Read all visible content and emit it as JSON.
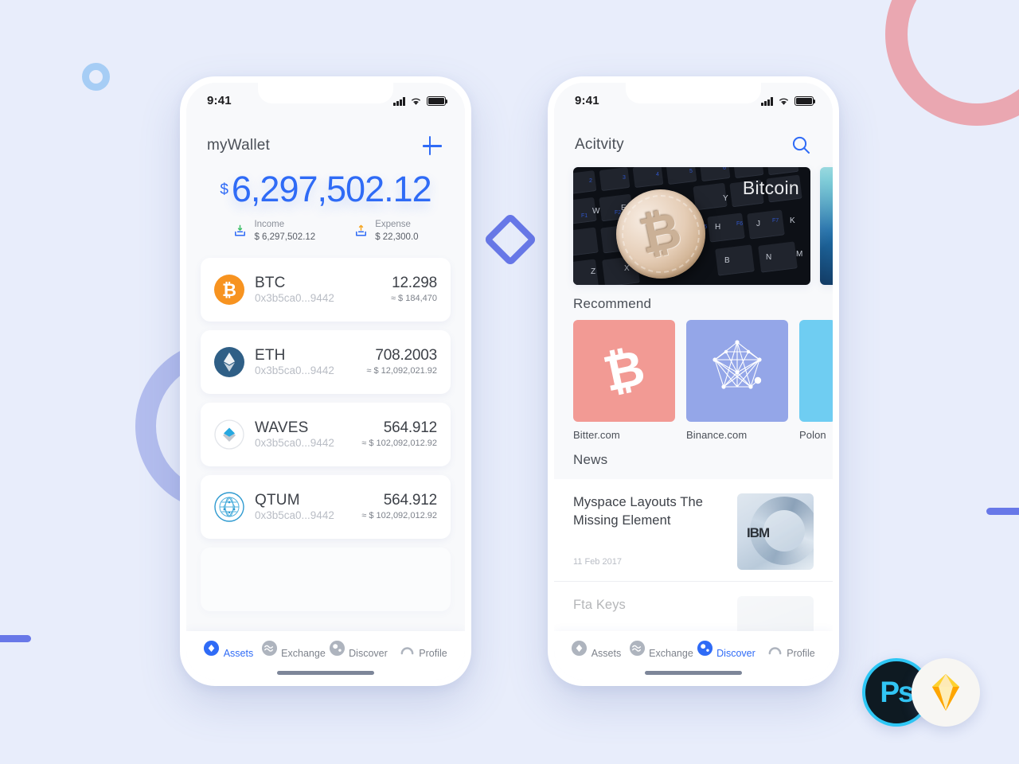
{
  "decor": {
    "pink_ring_color": "#eaa7b1",
    "purple_ring_color": "#b3bdee",
    "small_circle_color": "#a6cdf5",
    "diamond_color": "#6878e8",
    "bar_color": "#6878e8",
    "background_color": "#e8edfb"
  },
  "accent": "#2f6bf6",
  "phone_assets": {
    "status": {
      "time": "9:41"
    },
    "header": {
      "title": "myWallet",
      "add_label": "+"
    },
    "balance": {
      "currency_symbol": "$",
      "amount": "6,297,502.12",
      "income_label": "Income",
      "income_value": "$ 6,297,502.12",
      "expense_label": "Expense",
      "expense_value": "$ 22,300.0"
    },
    "assets": [
      {
        "symbol": "BTC",
        "address": "0x3b5ca0...9442",
        "quantity": "12.298",
        "fiat": "≈ $ 184,470",
        "icon": "bitcoin-icon",
        "color": "#f79320"
      },
      {
        "symbol": "ETH",
        "address": "0x3b5ca0...9442",
        "quantity": "708.2003",
        "fiat": "≈ $ 12,092,021.92",
        "icon": "ethereum-icon",
        "color": "#2f5f86"
      },
      {
        "symbol": "WAVES",
        "address": "0x3b5ca0...9442",
        "quantity": "564.912",
        "fiat": "≈ $ 102,092,012.92",
        "icon": "waves-icon",
        "color": "#26a8e0"
      },
      {
        "symbol": "QTUM",
        "address": "0x3b5ca0...9442",
        "quantity": "564.912",
        "fiat": "≈ $ 102,092,012.92",
        "icon": "qtum-icon",
        "color": "#2e9ad0"
      }
    ],
    "tabs": [
      {
        "label": "Assets",
        "icon": "diamond-icon",
        "active": true
      },
      {
        "label": "Exchange",
        "icon": "waves-icon",
        "active": false
      },
      {
        "label": "Discover",
        "icon": "compass-icon",
        "active": false
      },
      {
        "label": "Profile",
        "icon": "person-icon",
        "active": false
      }
    ]
  },
  "phone_discover": {
    "status": {
      "time": "9:41"
    },
    "header": {
      "title": "Acitvity",
      "search_icon": "search-icon"
    },
    "banners": [
      {
        "label": "Bitcoin",
        "image": "bitcoin-coin-on-keyboard"
      },
      {
        "label": "",
        "image": "teal-abstract"
      }
    ],
    "recommend": {
      "title": "Recommend",
      "items": [
        {
          "label": "Bitter.com",
          "icon": "bitcoin-icon",
          "color": "#f29a94"
        },
        {
          "label": "Binance.com",
          "icon": "network-icon",
          "color": "#94a6e8"
        },
        {
          "label": "Polon",
          "icon": "",
          "color": "#6fcdf2"
        }
      ]
    },
    "news": {
      "title": "News",
      "items": [
        {
          "title": "Myspace Layouts The Missing Element",
          "date": "11 Feb 2017",
          "thumb": "ibm-server-image"
        },
        {
          "title": "Fta Keys",
          "date": "",
          "thumb": "portrait-image"
        }
      ]
    },
    "tabs": [
      {
        "label": "Assets",
        "icon": "diamond-icon",
        "active": false
      },
      {
        "label": "Exchange",
        "icon": "waves-icon",
        "active": false
      },
      {
        "label": "Discover",
        "icon": "compass-icon",
        "active": true
      },
      {
        "label": "Profile",
        "icon": "person-icon",
        "active": false
      }
    ]
  },
  "tool_badges": [
    {
      "name": "photoshop",
      "label": "Ps"
    },
    {
      "name": "sketch",
      "label": ""
    }
  ]
}
